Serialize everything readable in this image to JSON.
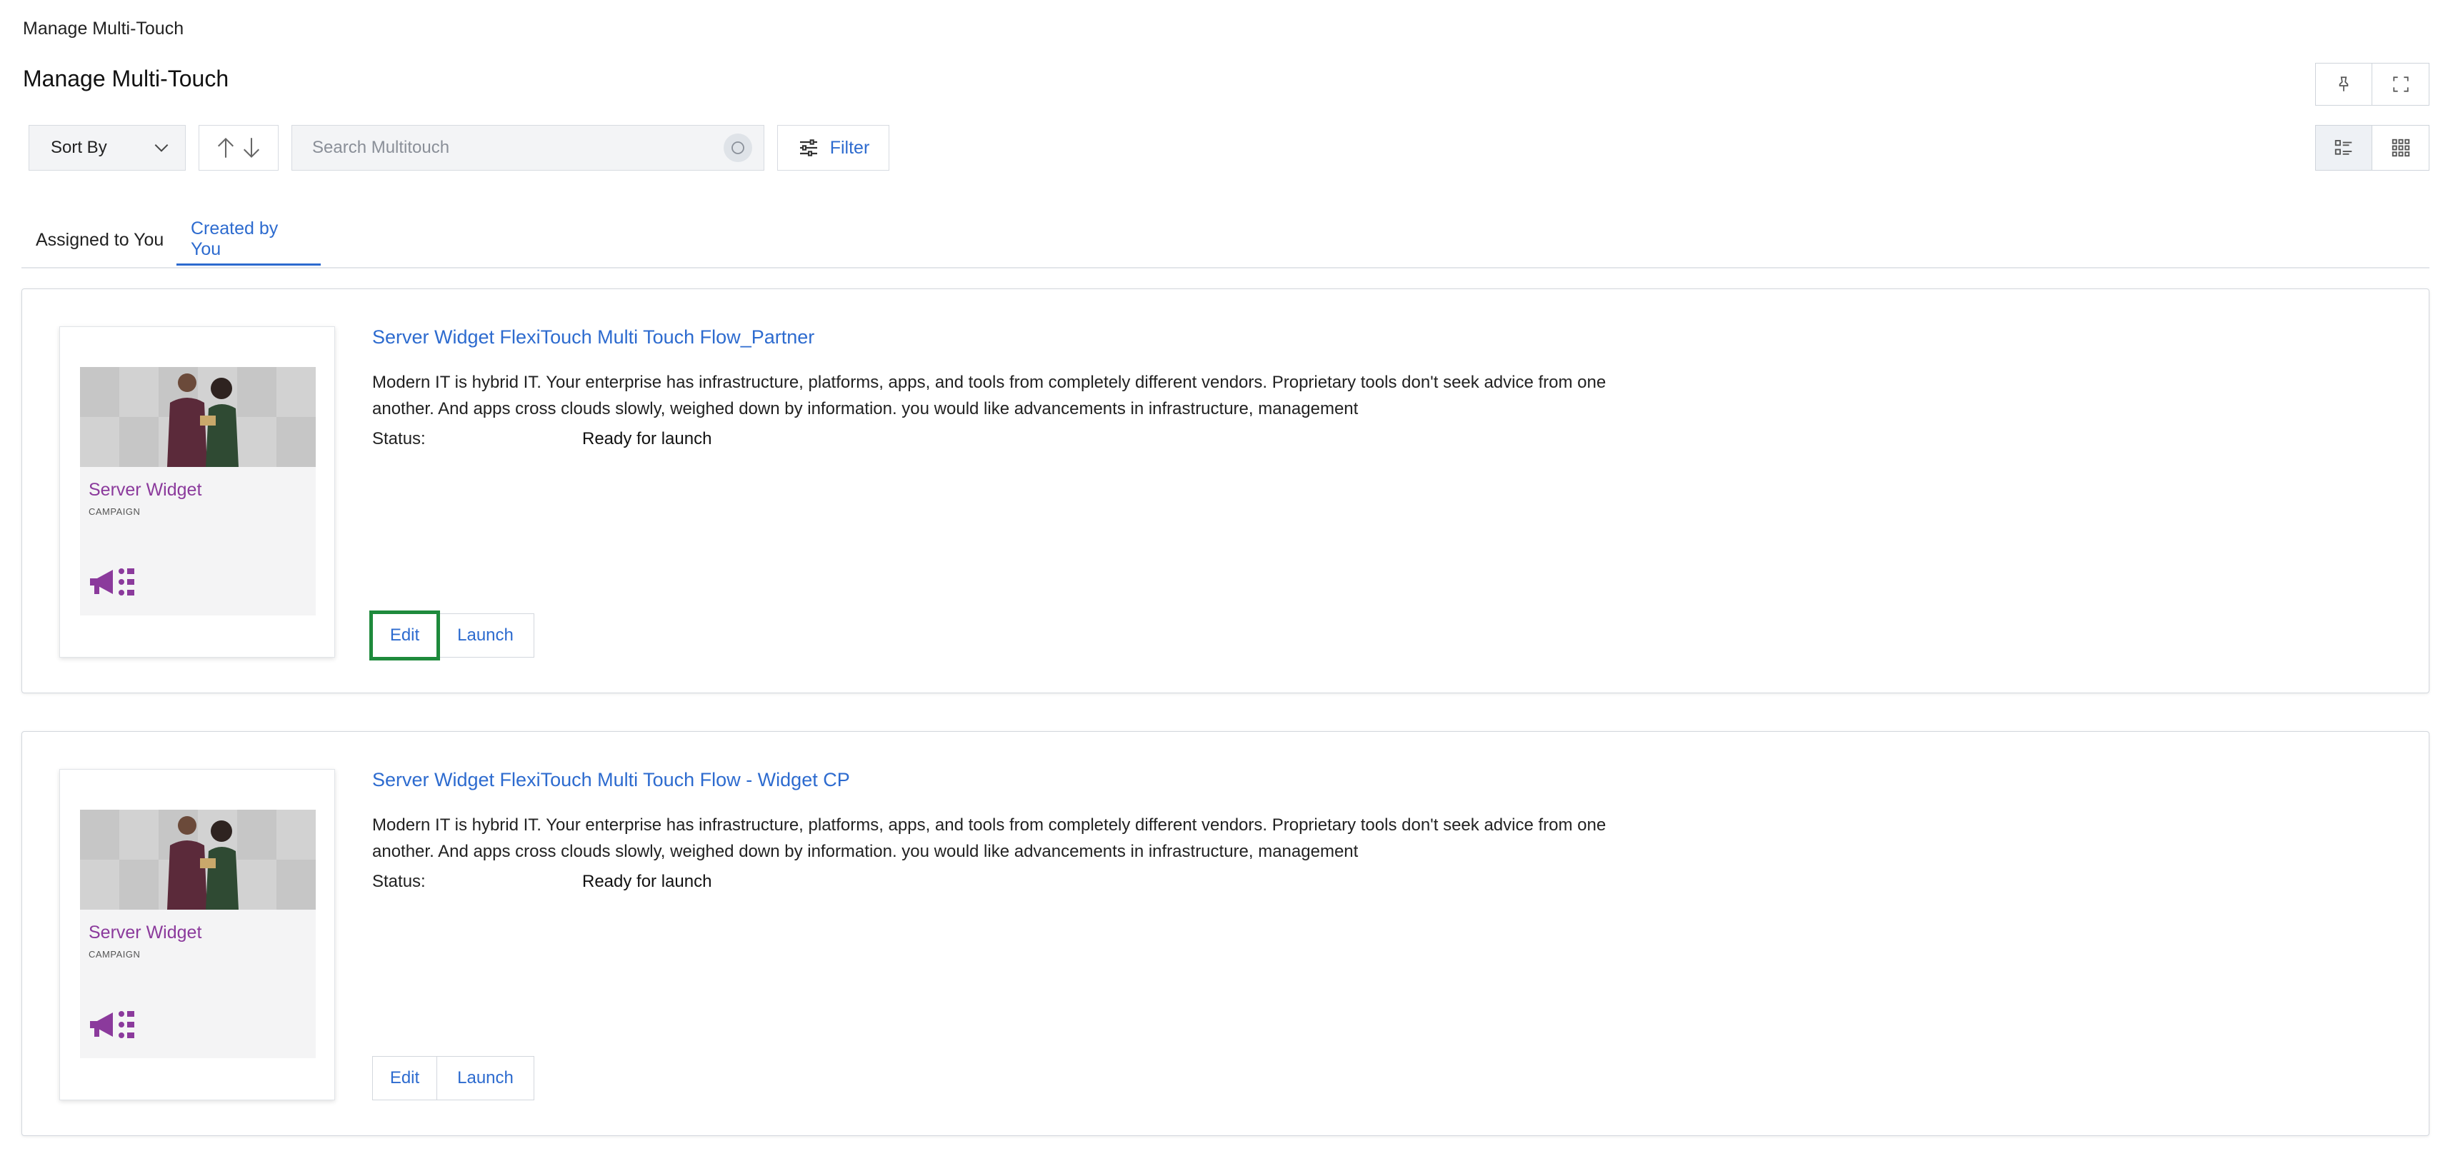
{
  "breadcrumb": "Manage Multi-Touch",
  "page_title": "Manage Multi-Touch",
  "toolbar": {
    "sort_label": "Sort By",
    "search_placeholder": "Search Multitouch",
    "filter_label": "Filter"
  },
  "tabs": [
    {
      "label": "Assigned to You",
      "active": false
    },
    {
      "label": "Created by You",
      "active": true
    }
  ],
  "cards": [
    {
      "title": "Server Widget FlexiTouch Multi Touch Flow_Partner",
      "description": "Modern IT is hybrid IT. Your enterprise has infrastructure, platforms, apps, and tools from completely different vendors. Proprietary tools don't seek advice from one another. And apps cross clouds slowly, weighed down by information. you would like advancements in infrastructure, management",
      "status_label": "Status:",
      "status_value": "Ready for launch",
      "thumb_title": "Server Widget",
      "thumb_subtitle": "CAMPAIGN",
      "edit_label": "Edit",
      "launch_label": "Launch"
    },
    {
      "title": "Server Widget FlexiTouch Multi Touch Flow - Widget CP",
      "description": "Modern IT is hybrid IT. Your enterprise has infrastructure, platforms, apps, and tools from completely different vendors. Proprietary tools don't seek advice from one another. And apps cross clouds slowly, weighed down by information. you would like advancements in infrastructure, management",
      "status_label": "Status:",
      "status_value": "Ready for launch",
      "thumb_title": "Server Widget",
      "thumb_subtitle": "CAMPAIGN",
      "edit_label": "Edit",
      "launch_label": "Launch"
    }
  ],
  "colors": {
    "accent": "#2d6bcf",
    "thumb_title": "#8b3a9c",
    "highlight": "#1e8a3c"
  },
  "icons": [
    "pin-icon",
    "fullscreen-icon",
    "chevron-down-icon",
    "sort-up-icon",
    "sort-down-icon",
    "search-icon",
    "filter-sliders-icon",
    "list-view-icon",
    "grid-view-icon",
    "megaphone-icon"
  ]
}
